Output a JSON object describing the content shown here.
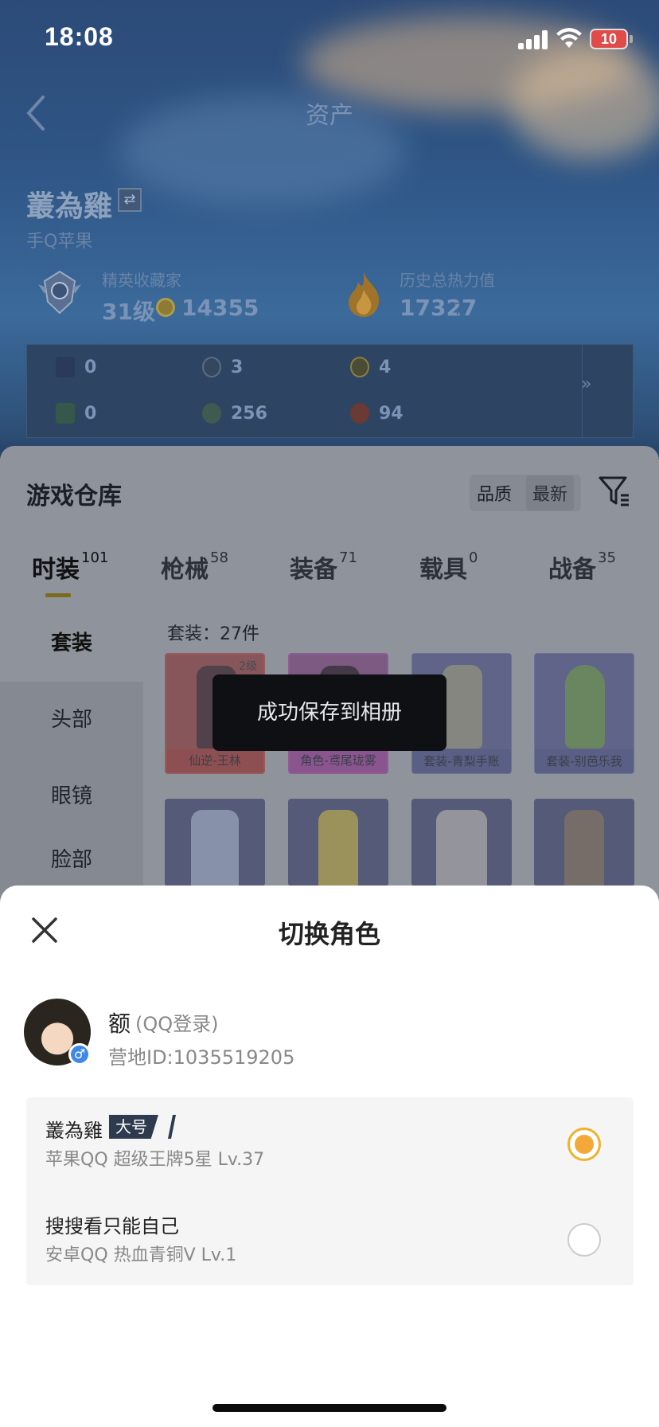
{
  "status": {
    "time": "18:08",
    "battery": "10"
  },
  "header": {
    "title": "资产"
  },
  "user": {
    "name": "叢為雞",
    "platform": "手Q苹果",
    "rank_label": "精英收藏家",
    "rank_level": "31级",
    "coins": "14355",
    "heat_label": "历史总热力值",
    "heat_value": "17327",
    "help": "?"
  },
  "stats": {
    "row1": [
      "0",
      "3",
      "4"
    ],
    "row2": [
      "0",
      "256",
      "94"
    ],
    "more": "»"
  },
  "warehouse": {
    "title": "游戏仓库",
    "sort": [
      "品质",
      "最新"
    ],
    "tabs": [
      {
        "label": "时装",
        "count": "101"
      },
      {
        "label": "枪械",
        "count": "58"
      },
      {
        "label": "装备",
        "count": "71"
      },
      {
        "label": "载具",
        "count": "0"
      },
      {
        "label": "战备",
        "count": "35"
      }
    ],
    "categories": [
      "套装",
      "头部",
      "眼镜",
      "脸部"
    ],
    "count_label": "套装：27件",
    "items": [
      {
        "caption": "仙逆-王林",
        "level": "2级"
      },
      {
        "caption": "角色-鸢尾珑雾",
        "level": ""
      },
      {
        "caption": "套装-青梨手账",
        "level": ""
      },
      {
        "caption": "套装-别芭乐我",
        "level": ""
      }
    ]
  },
  "toast": "成功保存到相册",
  "sheet": {
    "title": "切换角色",
    "account": {
      "name": "额",
      "login": "(QQ登录)",
      "id": "营地ID:1035519205",
      "gender": "♂"
    },
    "roles": [
      {
        "name": "叢為雞",
        "tag": "大号",
        "info": "苹果QQ   超级王牌5星   Lv.37",
        "selected": true
      },
      {
        "name": "搜搜看只能自己",
        "tag": "",
        "info": "安卓QQ   热血青铜V   Lv.1",
        "selected": false
      }
    ]
  },
  "colors": {
    "accent": "#f3a93a",
    "tab_underline": "#7c6a1e",
    "toast_bg": "#0e1014"
  }
}
